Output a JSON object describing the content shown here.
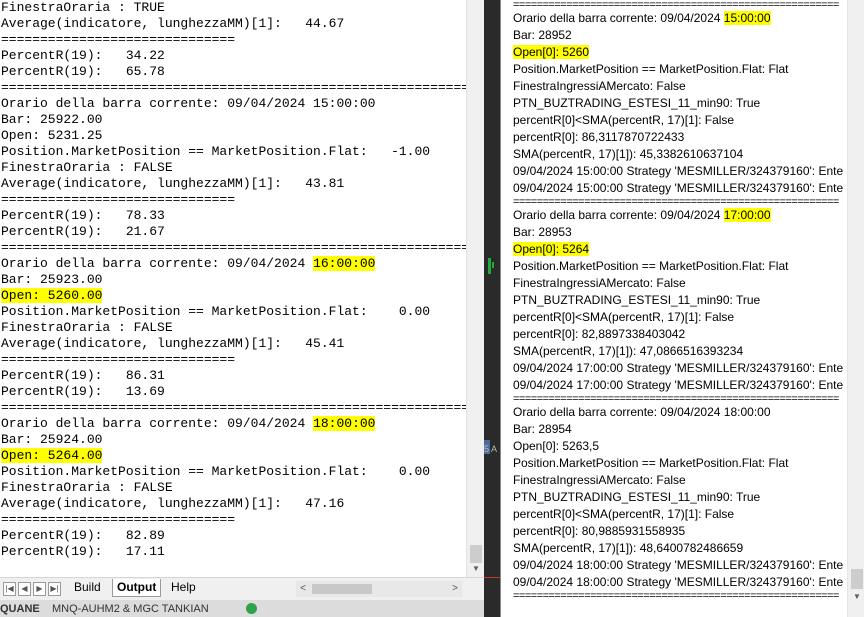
{
  "output_lines": [
    {
      "text": "FinestraOraria : TRUE"
    },
    {
      "text": "Average(indicatore, lunghezzaMM)[1]:   44.67"
    },
    {
      "text": "=============================="
    },
    {
      "text": "PercentR(19):   34.22"
    },
    {
      "text": "PercentR(19):   65.78"
    },
    {
      "text": "=============================================================="
    },
    {
      "text": "Orario della barra corrente: 09/04/2024 15:00:00"
    },
    {
      "text": "Bar: 25922.00"
    },
    {
      "text": "Open: 5231.25"
    },
    {
      "text": "Position.MarketPosition == MarketPosition.Flat:   -1.00"
    },
    {
      "text": "FinestraOraria : FALSE"
    },
    {
      "text": "Average(indicatore, lunghezzaMM)[1]:   43.81"
    },
    {
      "text": "=============================="
    },
    {
      "text": "PercentR(19):   78.33"
    },
    {
      "text": "PercentR(19):   21.67"
    },
    {
      "text": "=============================================================="
    },
    {
      "text": "Orario della barra corrente: 09/04/2024 ",
      "highlight": "16:00:00"
    },
    {
      "text": "Bar: 25923.00"
    },
    {
      "text": "",
      "highlight": "Open: 5260.00"
    },
    {
      "text": "Position.MarketPosition == MarketPosition.Flat:    0.00"
    },
    {
      "text": "FinestraOraria : FALSE"
    },
    {
      "text": "Average(indicatore, lunghezzaMM)[1]:   45.41"
    },
    {
      "text": "=============================="
    },
    {
      "text": "PercentR(19):   86.31"
    },
    {
      "text": "PercentR(19):   13.69"
    },
    {
      "text": "=============================================================="
    },
    {
      "text": "Orario della barra corrente: 09/04/2024 ",
      "highlight": "18:00:00"
    },
    {
      "text": "Bar: 25924.00"
    },
    {
      "text": "",
      "highlight": "Open: 5264.00"
    },
    {
      "text": "Position.MarketPosition == MarketPosition.Flat:    0.00"
    },
    {
      "text": "FinestraOraria : FALSE"
    },
    {
      "text": "Average(indicatore, lunghezzaMM)[1]:   47.16"
    },
    {
      "text": "=============================="
    },
    {
      "text": "PercentR(19):   82.89"
    },
    {
      "text": "PercentR(19):   17.11"
    }
  ],
  "tabs": {
    "build": "Build",
    "output": "Output",
    "help": "Help"
  },
  "taskbar": {
    "item1": "QUANE",
    "item2": "MNQ-AUHM2 & MGC TANKIAN"
  },
  "gap_text": "5 A",
  "right_lines": [
    {
      "type": "sep"
    },
    {
      "type": "text",
      "text": "Orario della barra corrente: 09/04/2024 ",
      "highlight": "15:00:00"
    },
    {
      "type": "text",
      "text": "Bar: 28952"
    },
    {
      "type": "text",
      "text": "",
      "highlight": "Open[0]: 5260"
    },
    {
      "type": "text",
      "text": "Position.MarketPosition == MarketPosition.Flat: Flat"
    },
    {
      "type": "text",
      "text": "FinestraIngressiAMercato: False"
    },
    {
      "type": "text",
      "text": "PTN_BUZTRADING_ESTESI_11_min90: True"
    },
    {
      "type": "text",
      "text": "percentR[0]<SMA(percentR, 17)[1]: False"
    },
    {
      "type": "text",
      "text": "percentR[0]: 86,3117870722433"
    },
    {
      "type": "text",
      "text": "SMA(percentR, 17)[1]): 45,3382610637104"
    },
    {
      "type": "text",
      "text": "09/04/2024 15:00:00 Strategy 'MESMILLER/324379160': Ente"
    },
    {
      "type": "text",
      "text": "09/04/2024 15:00:00 Strategy 'MESMILLER/324379160': Ente"
    },
    {
      "type": "sep"
    },
    {
      "type": "text",
      "text": "Orario della barra corrente: 09/04/2024 ",
      "highlight": "17:00:00"
    },
    {
      "type": "text",
      "text": "Bar: 28953"
    },
    {
      "type": "text",
      "text": "",
      "highlight": "Open[0]: 5264"
    },
    {
      "type": "text",
      "text": "Position.MarketPosition == MarketPosition.Flat: Flat"
    },
    {
      "type": "text",
      "text": "FinestraIngressiAMercato: False"
    },
    {
      "type": "text",
      "text": "PTN_BUZTRADING_ESTESI_11_min90: True"
    },
    {
      "type": "text",
      "text": "percentR[0]<SMA(percentR, 17)[1]: False"
    },
    {
      "type": "text",
      "text": "percentR[0]: 82,8897338403042"
    },
    {
      "type": "text",
      "text": "SMA(percentR, 17)[1]): 47,0866516393234"
    },
    {
      "type": "text",
      "text": "09/04/2024 17:00:00 Strategy 'MESMILLER/324379160': Ente"
    },
    {
      "type": "text",
      "text": "09/04/2024 17:00:00 Strategy 'MESMILLER/324379160': Ente"
    },
    {
      "type": "sep"
    },
    {
      "type": "text",
      "text": "Orario della barra corrente: 09/04/2024 18:00:00"
    },
    {
      "type": "text",
      "text": "Bar: 28954"
    },
    {
      "type": "text",
      "text": "Open[0]: 5263,5"
    },
    {
      "type": "text",
      "text": "Position.MarketPosition == MarketPosition.Flat: Flat"
    },
    {
      "type": "text",
      "text": "FinestraIngressiAMercato: False"
    },
    {
      "type": "text",
      "text": "PTN_BUZTRADING_ESTESI_11_min90: True"
    },
    {
      "type": "text",
      "text": "percentR[0]<SMA(percentR, 17)[1]: False"
    },
    {
      "type": "text",
      "text": "percentR[0]: 80,9885931558935"
    },
    {
      "type": "text",
      "text": "SMA(percentR, 17)[1]): 48,6400782486659"
    },
    {
      "type": "text",
      "text": "09/04/2024 18:00:00 Strategy 'MESMILLER/324379160': Ente"
    },
    {
      "type": "text",
      "text": "09/04/2024 18:00:00 Strategy 'MESMILLER/324379160': Ente"
    },
    {
      "type": "sep"
    }
  ],
  "separator_text": "=======================================================",
  "colors": {
    "highlight": "#ffff00",
    "scrollbar": "#f0f0f0",
    "dark_gap": "#2a2a2a",
    "indicator_green": "#1faa3b"
  },
  "icons": {
    "tab_prev_first": "first-arrow-icon",
    "tab_prev": "prev-arrow-icon",
    "tab_next": "next-arrow-icon",
    "tab_last": "last-arrow-icon",
    "scroll_left": "chevron-left-icon",
    "scroll_right": "chevron-right-icon",
    "scroll_down": "chevron-down-icon"
  }
}
